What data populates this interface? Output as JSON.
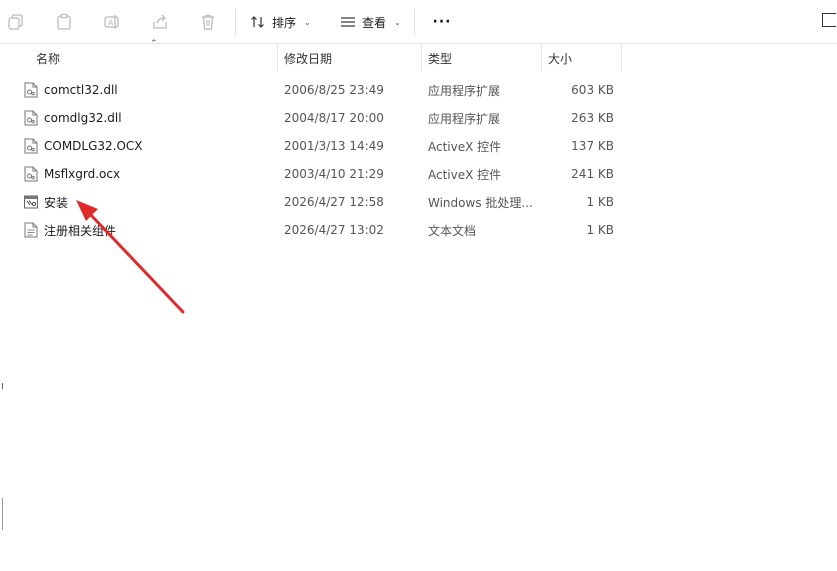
{
  "toolbar": {
    "sort_label": "排序",
    "view_label": "查看",
    "more_label": "···"
  },
  "columns": {
    "name": "名称",
    "date": "修改日期",
    "type": "类型",
    "size": "大小"
  },
  "files": [
    {
      "name": "comctl32.dll",
      "date": "2006/8/25 23:49",
      "type": "应用程序扩展",
      "size": "603 KB",
      "icon": "dll-file-icon"
    },
    {
      "name": "comdlg32.dll",
      "date": "2004/8/17 20:00",
      "type": "应用程序扩展",
      "size": "263 KB",
      "icon": "dll-file-icon"
    },
    {
      "name": "COMDLG32.OCX",
      "date": "2001/3/13 14:49",
      "type": "ActiveX 控件",
      "size": "137 KB",
      "icon": "activex-file-icon"
    },
    {
      "name": "Msflxgrd.ocx",
      "date": "2003/4/10 21:29",
      "type": "ActiveX 控件",
      "size": "241 KB",
      "icon": "activex-file-icon"
    },
    {
      "name": "安装",
      "date": "2026/4/27 12:58",
      "type": "Windows 批处理...",
      "size": "1 KB",
      "icon": "batch-file-icon"
    },
    {
      "name": "注册相关组件",
      "date": "2026/4/27 13:02",
      "type": "文本文档",
      "size": "1 KB",
      "icon": "text-file-icon"
    }
  ],
  "colors": {
    "annotation_arrow": "#e02a2a",
    "toolbar_icon_disabled": "#b8b8b8"
  }
}
